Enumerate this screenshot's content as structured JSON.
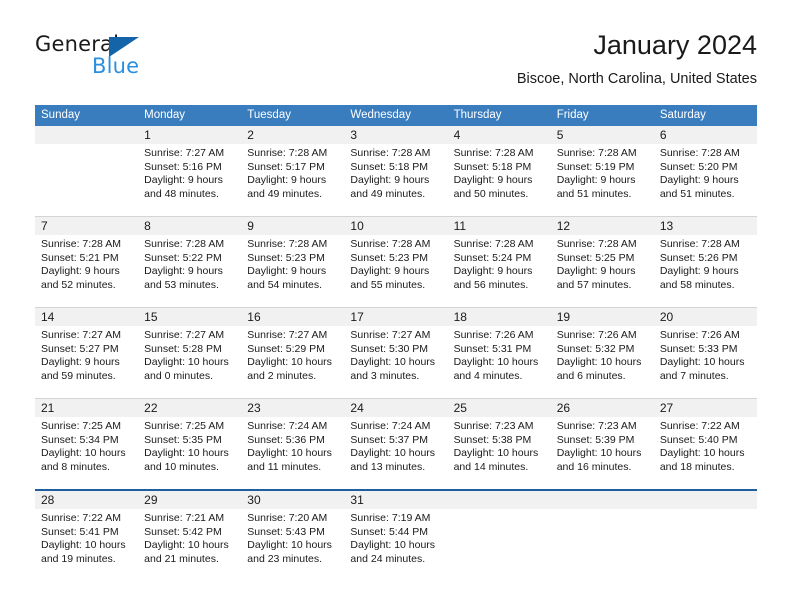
{
  "brand": {
    "name_part1": "General",
    "name_part2": "Blue",
    "triangle_color": "#1464aa",
    "blue_color": "#2b8fe0"
  },
  "header": {
    "title": "January 2024",
    "subtitle": "Biscoe, North Carolina, United States"
  },
  "theme": {
    "header_blue": "#3a7dbf",
    "last_row_border": "#1f5fa0",
    "band_gray": "#f1f1f1",
    "row_divider": "#d4d4d4"
  },
  "weekdays": [
    "Sunday",
    "Monday",
    "Tuesday",
    "Wednesday",
    "Thursday",
    "Friday",
    "Saturday"
  ],
  "weeks": [
    [
      {
        "day": "",
        "sunrise": "",
        "sunset": "",
        "daylight_line1": "",
        "daylight_line2": ""
      },
      {
        "day": "1",
        "sunrise": "Sunrise: 7:27 AM",
        "sunset": "Sunset: 5:16 PM",
        "daylight_line1": "Daylight: 9 hours",
        "daylight_line2": "and 48 minutes."
      },
      {
        "day": "2",
        "sunrise": "Sunrise: 7:28 AM",
        "sunset": "Sunset: 5:17 PM",
        "daylight_line1": "Daylight: 9 hours",
        "daylight_line2": "and 49 minutes."
      },
      {
        "day": "3",
        "sunrise": "Sunrise: 7:28 AM",
        "sunset": "Sunset: 5:18 PM",
        "daylight_line1": "Daylight: 9 hours",
        "daylight_line2": "and 49 minutes."
      },
      {
        "day": "4",
        "sunrise": "Sunrise: 7:28 AM",
        "sunset": "Sunset: 5:18 PM",
        "daylight_line1": "Daylight: 9 hours",
        "daylight_line2": "and 50 minutes."
      },
      {
        "day": "5",
        "sunrise": "Sunrise: 7:28 AM",
        "sunset": "Sunset: 5:19 PM",
        "daylight_line1": "Daylight: 9 hours",
        "daylight_line2": "and 51 minutes."
      },
      {
        "day": "6",
        "sunrise": "Sunrise: 7:28 AM",
        "sunset": "Sunset: 5:20 PM",
        "daylight_line1": "Daylight: 9 hours",
        "daylight_line2": "and 51 minutes."
      }
    ],
    [
      {
        "day": "7",
        "sunrise": "Sunrise: 7:28 AM",
        "sunset": "Sunset: 5:21 PM",
        "daylight_line1": "Daylight: 9 hours",
        "daylight_line2": "and 52 minutes."
      },
      {
        "day": "8",
        "sunrise": "Sunrise: 7:28 AM",
        "sunset": "Sunset: 5:22 PM",
        "daylight_line1": "Daylight: 9 hours",
        "daylight_line2": "and 53 minutes."
      },
      {
        "day": "9",
        "sunrise": "Sunrise: 7:28 AM",
        "sunset": "Sunset: 5:23 PM",
        "daylight_line1": "Daylight: 9 hours",
        "daylight_line2": "and 54 minutes."
      },
      {
        "day": "10",
        "sunrise": "Sunrise: 7:28 AM",
        "sunset": "Sunset: 5:23 PM",
        "daylight_line1": "Daylight: 9 hours",
        "daylight_line2": "and 55 minutes."
      },
      {
        "day": "11",
        "sunrise": "Sunrise: 7:28 AM",
        "sunset": "Sunset: 5:24 PM",
        "daylight_line1": "Daylight: 9 hours",
        "daylight_line2": "and 56 minutes."
      },
      {
        "day": "12",
        "sunrise": "Sunrise: 7:28 AM",
        "sunset": "Sunset: 5:25 PM",
        "daylight_line1": "Daylight: 9 hours",
        "daylight_line2": "and 57 minutes."
      },
      {
        "day": "13",
        "sunrise": "Sunrise: 7:28 AM",
        "sunset": "Sunset: 5:26 PM",
        "daylight_line1": "Daylight: 9 hours",
        "daylight_line2": "and 58 minutes."
      }
    ],
    [
      {
        "day": "14",
        "sunrise": "Sunrise: 7:27 AM",
        "sunset": "Sunset: 5:27 PM",
        "daylight_line1": "Daylight: 9 hours",
        "daylight_line2": "and 59 minutes."
      },
      {
        "day": "15",
        "sunrise": "Sunrise: 7:27 AM",
        "sunset": "Sunset: 5:28 PM",
        "daylight_line1": "Daylight: 10 hours",
        "daylight_line2": "and 0 minutes."
      },
      {
        "day": "16",
        "sunrise": "Sunrise: 7:27 AM",
        "sunset": "Sunset: 5:29 PM",
        "daylight_line1": "Daylight: 10 hours",
        "daylight_line2": "and 2 minutes."
      },
      {
        "day": "17",
        "sunrise": "Sunrise: 7:27 AM",
        "sunset": "Sunset: 5:30 PM",
        "daylight_line1": "Daylight: 10 hours",
        "daylight_line2": "and 3 minutes."
      },
      {
        "day": "18",
        "sunrise": "Sunrise: 7:26 AM",
        "sunset": "Sunset: 5:31 PM",
        "daylight_line1": "Daylight: 10 hours",
        "daylight_line2": "and 4 minutes."
      },
      {
        "day": "19",
        "sunrise": "Sunrise: 7:26 AM",
        "sunset": "Sunset: 5:32 PM",
        "daylight_line1": "Daylight: 10 hours",
        "daylight_line2": "and 6 minutes."
      },
      {
        "day": "20",
        "sunrise": "Sunrise: 7:26 AM",
        "sunset": "Sunset: 5:33 PM",
        "daylight_line1": "Daylight: 10 hours",
        "daylight_line2": "and 7 minutes."
      }
    ],
    [
      {
        "day": "21",
        "sunrise": "Sunrise: 7:25 AM",
        "sunset": "Sunset: 5:34 PM",
        "daylight_line1": "Daylight: 10 hours",
        "daylight_line2": "and 8 minutes."
      },
      {
        "day": "22",
        "sunrise": "Sunrise: 7:25 AM",
        "sunset": "Sunset: 5:35 PM",
        "daylight_line1": "Daylight: 10 hours",
        "daylight_line2": "and 10 minutes."
      },
      {
        "day": "23",
        "sunrise": "Sunrise: 7:24 AM",
        "sunset": "Sunset: 5:36 PM",
        "daylight_line1": "Daylight: 10 hours",
        "daylight_line2": "and 11 minutes."
      },
      {
        "day": "24",
        "sunrise": "Sunrise: 7:24 AM",
        "sunset": "Sunset: 5:37 PM",
        "daylight_line1": "Daylight: 10 hours",
        "daylight_line2": "and 13 minutes."
      },
      {
        "day": "25",
        "sunrise": "Sunrise: 7:23 AM",
        "sunset": "Sunset: 5:38 PM",
        "daylight_line1": "Daylight: 10 hours",
        "daylight_line2": "and 14 minutes."
      },
      {
        "day": "26",
        "sunrise": "Sunrise: 7:23 AM",
        "sunset": "Sunset: 5:39 PM",
        "daylight_line1": "Daylight: 10 hours",
        "daylight_line2": "and 16 minutes."
      },
      {
        "day": "27",
        "sunrise": "Sunrise: 7:22 AM",
        "sunset": "Sunset: 5:40 PM",
        "daylight_line1": "Daylight: 10 hours",
        "daylight_line2": "and 18 minutes."
      }
    ],
    [
      {
        "day": "28",
        "sunrise": "Sunrise: 7:22 AM",
        "sunset": "Sunset: 5:41 PM",
        "daylight_line1": "Daylight: 10 hours",
        "daylight_line2": "and 19 minutes."
      },
      {
        "day": "29",
        "sunrise": "Sunrise: 7:21 AM",
        "sunset": "Sunset: 5:42 PM",
        "daylight_line1": "Daylight: 10 hours",
        "daylight_line2": "and 21 minutes."
      },
      {
        "day": "30",
        "sunrise": "Sunrise: 7:20 AM",
        "sunset": "Sunset: 5:43 PM",
        "daylight_line1": "Daylight: 10 hours",
        "daylight_line2": "and 23 minutes."
      },
      {
        "day": "31",
        "sunrise": "Sunrise: 7:19 AM",
        "sunset": "Sunset: 5:44 PM",
        "daylight_line1": "Daylight: 10 hours",
        "daylight_line2": "and 24 minutes."
      },
      {
        "day": "",
        "sunrise": "",
        "sunset": "",
        "daylight_line1": "",
        "daylight_line2": ""
      },
      {
        "day": "",
        "sunrise": "",
        "sunset": "",
        "daylight_line1": "",
        "daylight_line2": ""
      },
      {
        "day": "",
        "sunrise": "",
        "sunset": "",
        "daylight_line1": "",
        "daylight_line2": ""
      }
    ]
  ]
}
